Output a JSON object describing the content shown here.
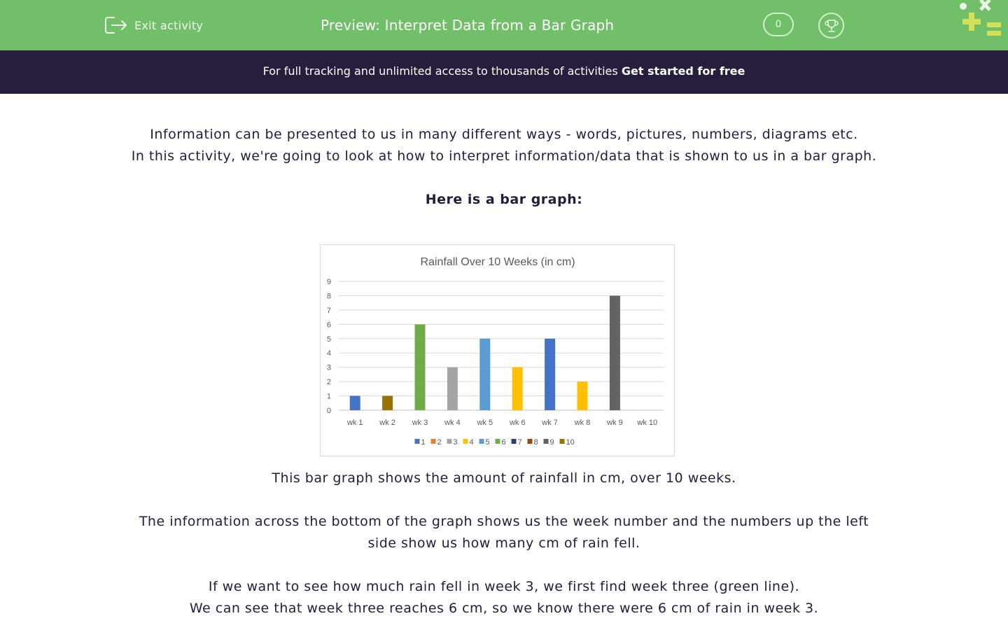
{
  "header": {
    "exit_label": "Exit activity",
    "title": "Preview: Interpret Data from a Bar Graph",
    "score": "0",
    "bg_color": "#72bf6a"
  },
  "banner": {
    "text": "For full tracking and unlimited access to thousands of activities ",
    "cta": "Get started for free",
    "bg_color": "#271e3e"
  },
  "intro": {
    "line1": "Information can be presented to us in many different ways - words, pictures, numbers, diagrams etc.",
    "line2": "In this activity, we're going to look at how to interpret information/data that is shown to us in a bar graph.",
    "heading": "Here is a bar graph:"
  },
  "chart_data": {
    "type": "bar",
    "title": "Rainfall Over 10 Weeks (in cm)",
    "categories": [
      "wk 1",
      "wk 2",
      "wk 3",
      "wk 4",
      "wk 5",
      "wk 6",
      "wk 7",
      "wk 8",
      "wk 9",
      "wk 10"
    ],
    "values": [
      1,
      1,
      6,
      3,
      5,
      3,
      5,
      2,
      8,
      0
    ],
    "colors": [
      "#4472c4",
      "#997300",
      "#70ad47",
      "#a5a5a5",
      "#5b9bd5",
      "#ffc000",
      "#4472c4",
      "#ffc000",
      "#636363",
      "#997300"
    ],
    "yticks": [
      0,
      1,
      2,
      3,
      4,
      5,
      6,
      7,
      8,
      9
    ],
    "ylim": [
      0,
      9
    ],
    "grid": true,
    "legend_position": "bottom",
    "legend": [
      {
        "label": "1",
        "color": "#4472c4"
      },
      {
        "label": "2",
        "color": "#ed7d31"
      },
      {
        "label": "3",
        "color": "#a5a5a5"
      },
      {
        "label": "4",
        "color": "#ffc000"
      },
      {
        "label": "5",
        "color": "#5b9bd5"
      },
      {
        "label": "6",
        "color": "#70ad47"
      },
      {
        "label": "7",
        "color": "#264478"
      },
      {
        "label": "8",
        "color": "#9e480e"
      },
      {
        "label": "9",
        "color": "#636363"
      },
      {
        "label": "10",
        "color": "#997300"
      }
    ]
  },
  "explanation": {
    "line1": "This bar graph shows the amount of rainfall in cm, over 10 weeks.",
    "line2": "The information across the bottom of the graph shows us the week number and the numbers up the left",
    "line3": "side show us how many cm of rain fell.",
    "line4": "If we want to see how much rain fell in week 3, we first find week three (green line).",
    "line5": "We can see that week three reaches 6 cm, so we know there were 6 cm of rain in week 3."
  }
}
